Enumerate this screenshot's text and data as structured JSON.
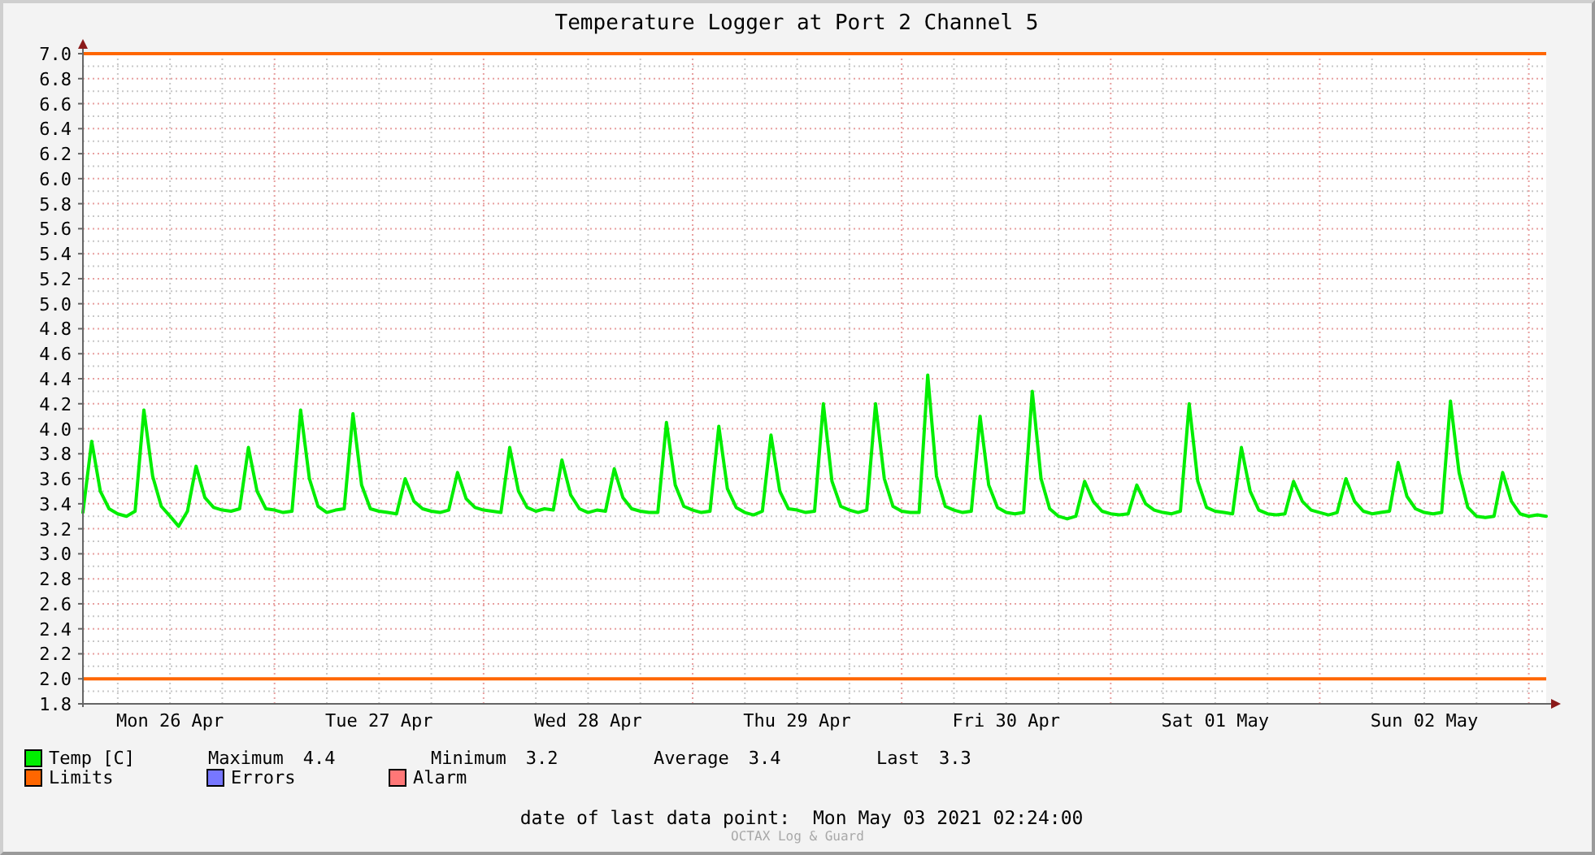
{
  "chart": {
    "chart_data": {
      "type": "line",
      "title": "Temperature Logger at Port 2 Channel 5",
      "categories": [
        null,
        null,
        null,
        null,
        null,
        null,
        null,
        null,
        null,
        null,
        "Mon 26 Apr",
        null,
        null,
        null,
        null,
        null,
        null,
        null,
        null,
        null,
        null,
        null,
        null,
        null,
        null,
        null,
        null,
        null,
        null,
        null,
        null,
        null,
        null,
        null,
        "Tue 27 Apr",
        null,
        null,
        null,
        null,
        null,
        null,
        null,
        null,
        null,
        null,
        null,
        null,
        null,
        null,
        null,
        null,
        null,
        null,
        null,
        null,
        null,
        null,
        null,
        "Wed 28 Apr",
        null,
        null,
        null,
        null,
        null,
        null,
        null,
        null,
        null,
        null,
        null,
        null,
        null,
        null,
        null,
        null,
        null,
        null,
        null,
        null,
        null,
        null,
        null,
        "Thu 29 Apr",
        null,
        null,
        null,
        null,
        null,
        null,
        null,
        null,
        null,
        null,
        null,
        null,
        null,
        null,
        null,
        null,
        null,
        null,
        null,
        null,
        null,
        null,
        null,
        "Fri 30 Apr",
        null,
        null,
        null,
        null,
        null,
        null,
        null,
        null,
        null,
        null,
        null,
        null,
        null,
        null,
        null,
        null,
        null,
        null,
        null,
        null,
        null,
        null,
        null,
        "Sat 01 May",
        null,
        null,
        null,
        null,
        null,
        null,
        null,
        null,
        null,
        null,
        null,
        null,
        null,
        null,
        null,
        null,
        null,
        null,
        null,
        null,
        null,
        null,
        null,
        "Sun 02 May",
        null,
        null,
        null,
        null,
        null,
        null,
        null,
        null,
        null,
        null,
        null,
        null,
        null,
        null
      ],
      "series": [
        {
          "name": "Temp [C]",
          "color": "#00ee00",
          "values": [
            3.33,
            3.9,
            3.5,
            3.36,
            3.32,
            3.3,
            3.34,
            4.15,
            3.62,
            3.38,
            3.3,
            3.22,
            3.34,
            3.7,
            3.45,
            3.37,
            3.35,
            3.34,
            3.36,
            3.85,
            3.5,
            3.36,
            3.35,
            3.33,
            3.34,
            4.15,
            3.6,
            3.38,
            3.33,
            3.35,
            3.36,
            4.12,
            3.55,
            3.36,
            3.34,
            3.33,
            3.32,
            3.6,
            3.42,
            3.36,
            3.34,
            3.33,
            3.35,
            3.65,
            3.44,
            3.37,
            3.35,
            3.34,
            3.33,
            3.85,
            3.5,
            3.37,
            3.34,
            3.36,
            3.35,
            3.75,
            3.47,
            3.36,
            3.33,
            3.35,
            3.34,
            3.68,
            3.45,
            3.36,
            3.34,
            3.33,
            3.33,
            4.05,
            3.55,
            3.38,
            3.35,
            3.33,
            3.34,
            4.02,
            3.52,
            3.37,
            3.33,
            3.31,
            3.34,
            3.95,
            3.5,
            3.36,
            3.35,
            3.33,
            3.34,
            4.2,
            3.58,
            3.38,
            3.35,
            3.33,
            3.35,
            4.2,
            3.6,
            3.38,
            3.34,
            3.33,
            3.33,
            4.43,
            3.62,
            3.38,
            3.35,
            3.33,
            3.34,
            4.1,
            3.55,
            3.37,
            3.33,
            3.32,
            3.33,
            4.3,
            3.6,
            3.36,
            3.3,
            3.28,
            3.3,
            3.58,
            3.42,
            3.34,
            3.32,
            3.31,
            3.32,
            3.55,
            3.4,
            3.35,
            3.33,
            3.32,
            3.34,
            4.2,
            3.58,
            3.37,
            3.34,
            3.33,
            3.32,
            3.85,
            3.5,
            3.35,
            3.32,
            3.31,
            3.32,
            3.58,
            3.42,
            3.35,
            3.33,
            3.31,
            3.33,
            3.6,
            3.42,
            3.34,
            3.32,
            3.33,
            3.34,
            3.73,
            3.46,
            3.36,
            3.33,
            3.32,
            3.33,
            4.22,
            3.65,
            3.37,
            3.3,
            3.29,
            3.3,
            3.65,
            3.42,
            3.32,
            3.3,
            3.31,
            3.3
          ]
        }
      ],
      "ylim": [
        1.8,
        7.0
      ],
      "yticks": [
        {
          "value": 1.8,
          "label": "1.8"
        },
        {
          "value": 2.0,
          "label": "2.0"
        },
        {
          "value": 2.2,
          "label": "2.2"
        },
        {
          "value": 2.4,
          "label": "2.4"
        },
        {
          "value": 2.6,
          "label": "2.6"
        },
        {
          "value": 2.8,
          "label": "2.8"
        },
        {
          "value": 3.0,
          "label": "3.0"
        },
        {
          "value": 3.2,
          "label": "3.2"
        },
        {
          "value": 3.4,
          "label": "3.4"
        },
        {
          "value": 3.6,
          "label": "3.6"
        },
        {
          "value": 3.8,
          "label": "3.8"
        },
        {
          "value": 4.0,
          "label": "4.0"
        },
        {
          "value": 4.2,
          "label": "4.2"
        },
        {
          "value": 4.4,
          "label": "4.4"
        },
        {
          "value": 4.6,
          "label": "4.6"
        },
        {
          "value": 4.8,
          "label": "4.8"
        },
        {
          "value": 5.0,
          "label": "5.0"
        },
        {
          "value": 5.2,
          "label": "5.2"
        },
        {
          "value": 5.4,
          "label": "5.4"
        },
        {
          "value": 5.6,
          "label": "5.6"
        },
        {
          "value": 5.8,
          "label": "5.8"
        },
        {
          "value": 6.0,
          "label": "6.0"
        },
        {
          "value": 6.2,
          "label": "6.2"
        },
        {
          "value": 6.4,
          "label": "6.4"
        },
        {
          "value": 6.6,
          "label": "6.6"
        },
        {
          "value": 6.8,
          "label": "6.8"
        },
        {
          "value": 7.0,
          "label": "7.0"
        }
      ],
      "grid": true,
      "ref_lines": [
        {
          "axis": "y",
          "value": 7.0
        },
        {
          "axis": "y",
          "value": 2.0
        }
      ]
    }
  },
  "legend": [
    {
      "label": "Limits",
      "color": "#ff6600"
    },
    {
      "label": "Errors",
      "color": "#7777ff"
    },
    {
      "label": "Alarm",
      "color": "#ff7777"
    }
  ],
  "stats": [
    {
      "label": "Maximum",
      "value": "4.4"
    },
    {
      "label": "Minimum",
      "value": "3.2"
    },
    {
      "label": "Average",
      "value": "3.4"
    },
    {
      "label": "Last",
      "value": "3.3"
    }
  ],
  "footer": {
    "label": "date of last data point:",
    "value": "Mon May 03 2021 02:24:00"
  },
  "watermark": "OCTAX Log & Guard"
}
